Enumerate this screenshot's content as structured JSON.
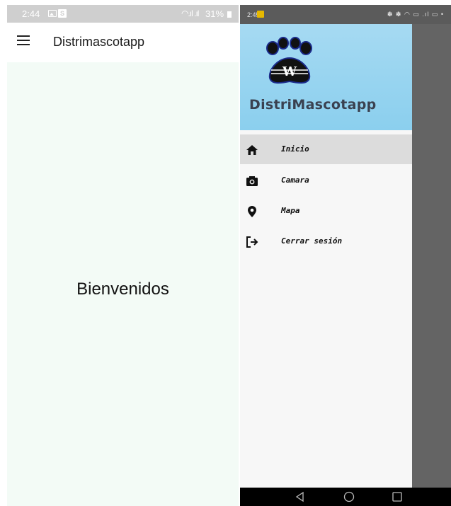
{
  "left_screen": {
    "status_bar": {
      "time": "2:44",
      "battery": "31%",
      "signal": "◠.ıl .ıl"
    },
    "app_bar": {
      "title": "Distrimascotapp"
    },
    "body_text": "Bienvenidos"
  },
  "right_screen": {
    "status_bar": {
      "time": "2:45",
      "right_icons": "✽ ✽ ◠ ▭ .ıl ▭ •"
    },
    "drawer": {
      "logo_letter": "W",
      "title": "DistriMascotapp",
      "items": [
        {
          "label": "Inicio",
          "icon": "home-icon",
          "active": true
        },
        {
          "label": "Camara",
          "icon": "camera-icon",
          "active": false
        },
        {
          "label": "Mapa",
          "icon": "map-pin-icon",
          "active": false
        },
        {
          "label": "Cerrar sesión",
          "icon": "logout-icon",
          "active": false
        }
      ]
    },
    "nav_bar": [
      "back-icon",
      "home-circle-icon",
      "recents-icon"
    ]
  },
  "colors": {
    "drawer_header": "#8bcfee",
    "active_item": "#dcdcdc",
    "left_background": "#f3fbf6",
    "scrim": "#646464"
  }
}
